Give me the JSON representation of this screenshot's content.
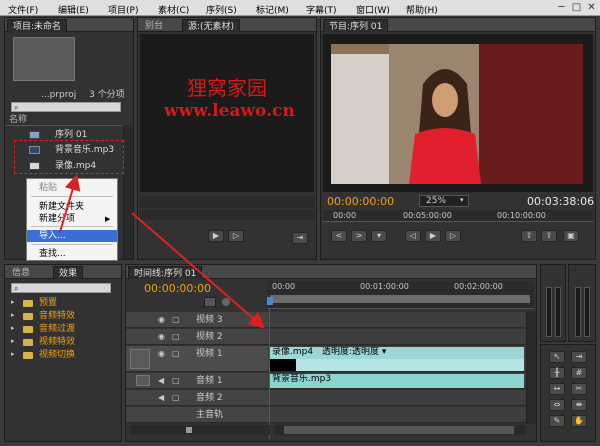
{
  "menu": {
    "items": [
      "文件(F)",
      "编辑(E)",
      "项目(P)",
      "素材(C)",
      "序列(S)",
      "标记(M)",
      "字幕(T)",
      "窗口(W)",
      "帮助(H)"
    ]
  },
  "window_controls": {
    "minimize": "─",
    "maximize": "□",
    "close": "✕"
  },
  "project_panel": {
    "tab_label": "项目:未命名",
    "filename": "...prproj",
    "count": "3 个分项",
    "name_header": "名称",
    "items": [
      {
        "label": "序列 01"
      },
      {
        "label": "背景音乐.mp3"
      },
      {
        "label": "录像.mp4"
      }
    ]
  },
  "context_menu": {
    "items": [
      "粘贴",
      "新建文件夹",
      "新建分项",
      "导入...",
      "查找..."
    ]
  },
  "source_panel": {
    "tabs": [
      "别台",
      "源:(无素材)"
    ]
  },
  "watermark": {
    "line1": "狸窝家园",
    "line2": "www.leawo.cn"
  },
  "program_panel": {
    "tab_label": "节目:序列 01",
    "timecode": "00:00:00:00",
    "zoom": "25%",
    "duration": "00:03:38:06",
    "ruler": [
      "00:00",
      "00:05:00:00",
      "00:10:00:00"
    ]
  },
  "effects_panel": {
    "tabs": [
      "信息",
      "效果"
    ],
    "folders": [
      "预置",
      "音频特效",
      "音频过渡",
      "视频特效",
      "视频切换"
    ]
  },
  "timeline": {
    "tab_label": "时间线:序列 01",
    "timecode": "00:00:00:00",
    "ruler": [
      "00:00",
      "00:01:00:00",
      "00:02:00:00"
    ],
    "tracks": [
      {
        "name": "视频 3"
      },
      {
        "name": "视频 2"
      },
      {
        "name": "视频 1"
      },
      {
        "name": "音频 1"
      },
      {
        "name": "音频 2"
      },
      {
        "name": "主音轨"
      }
    ],
    "video_clip": {
      "name": "录像.mp4",
      "effect1": "透明度:透明度"
    },
    "audio_clip": {
      "name": "背景音乐.mp3"
    }
  },
  "colors": {
    "accent": "#f0a010",
    "selection": "#3b6fd6",
    "annotation_red": "#e02020",
    "video_clip": "#9ad7d6",
    "audio_clip": "#8fd3d0"
  }
}
